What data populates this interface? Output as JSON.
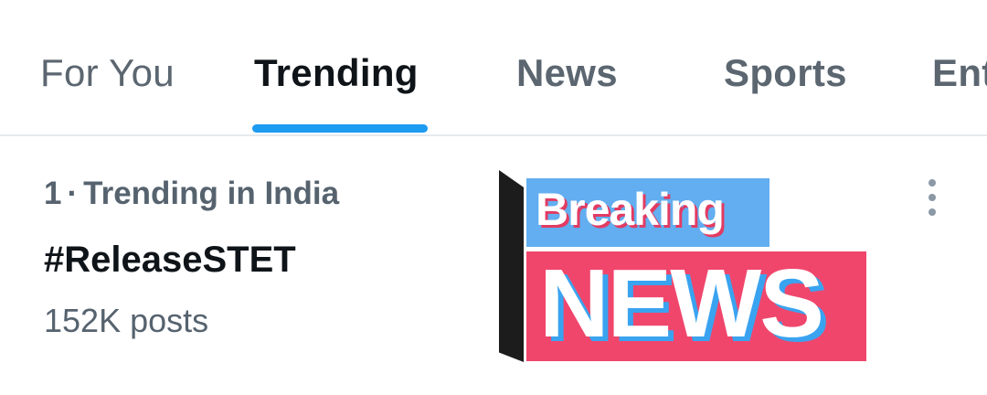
{
  "tabs": [
    {
      "label": "For You",
      "active": false
    },
    {
      "label": "Trending",
      "active": true
    },
    {
      "label": "News",
      "active": false
    },
    {
      "label": "Sports",
      "active": false
    },
    {
      "label": "Ent",
      "active": false
    }
  ],
  "accent_color": "#1d9bf0",
  "trend": {
    "rank": "1",
    "separator": "·",
    "context": "Trending in India",
    "title": "#ReleaseSTET",
    "count": "152K posts"
  },
  "image": {
    "top_text": "Breaking",
    "bottom_text": "NEWS",
    "colors": {
      "top_box": "#62aef0",
      "bottom_box": "#f0466c",
      "bar": "#1c1c1c"
    }
  },
  "more_icon": "more-vertical-icon"
}
